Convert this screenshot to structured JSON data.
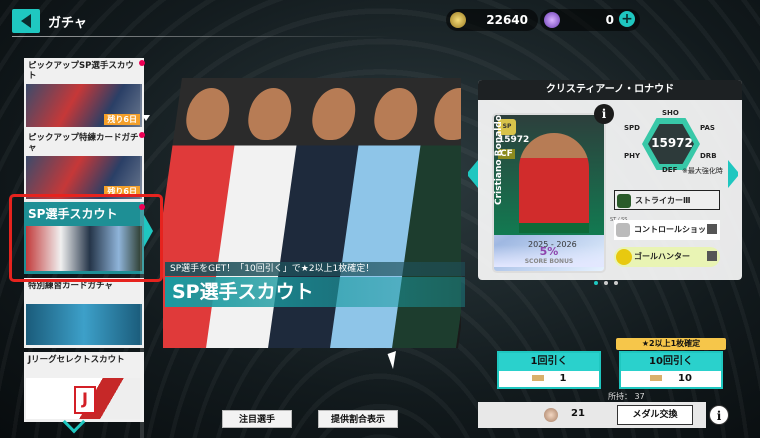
{
  "header": {
    "title": "ガチャ",
    "coins": "22640",
    "gems": "0"
  },
  "sidebar": {
    "items": [
      {
        "label": "ピックアップSP選手スカウト",
        "badge": "残り6日"
      },
      {
        "label": "ピックアップ特練カードガチャ",
        "badge": "残り6日"
      },
      {
        "label": "SP選手スカウト"
      },
      {
        "label": "特別練習カードガチャ"
      },
      {
        "label": "Jリーグセレクトスカウト",
        "logo_text": "J"
      }
    ]
  },
  "banner": {
    "subtitle": "SP選手をGET！「10回引く」で★2以上1枚確定！",
    "title": "SP選手スカウト",
    "btn_notable": "注目選手",
    "btn_rates": "提供割合表示"
  },
  "card": {
    "player_name": "クリスティアーノ・ロナウド",
    "ovr": "15972",
    "position": "CF",
    "vertical_name": "Cristiano Ronaldo",
    "season": "2025 - 2026",
    "bonus": "5%",
    "bonus_label": "SCORE BONUS",
    "overall": "15972",
    "stats": {
      "sho": "SHO",
      "spd": "SPD",
      "pas": "PAS",
      "phy": "PHY",
      "drb": "DRB",
      "def": "DEF"
    },
    "max_level": "※最大強化時",
    "skills": [
      "ストライカーⅢ",
      "コントロールショット",
      "ゴールハンター"
    ],
    "skill_small": "ST / SS"
  },
  "pull": {
    "guarantee": "★2以上1枚確定",
    "single_label": "1回引く",
    "single_cost": "1",
    "ten_label": "10回引く",
    "ten_cost": "10",
    "owned": "所持： 37",
    "medals": "21",
    "medal_exchange": "メダル交換"
  }
}
